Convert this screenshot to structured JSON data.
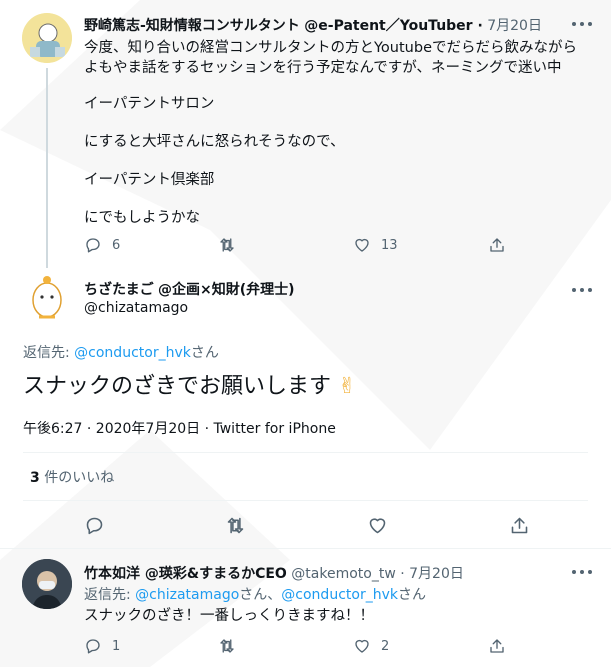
{
  "tweet1": {
    "name": "野崎篤志-知財情報コンサルタント",
    "handle_time": "@e-Patent／YouTuber ·",
    "date": "7月20日",
    "lines": [
      "今度、知り合いの経営コンサルタントの方とYoutubeでだらだら飲みながら",
      "よもやま話をするセッションを行う予定なんですが、ネーミングで迷い中",
      "イーパテントサロン",
      "にすると大坪さんに怒られそうなので、",
      "イーパテント倶楽部",
      "にでもしようかな"
    ],
    "reply_count": "6",
    "like_count": "13"
  },
  "tweet2": {
    "name": "ちざたまご",
    "name_suffix": "@企画×知財(弁理士)",
    "handle": "@chizatamago",
    "reply_prefix": "返信先:",
    "reply_to": "@conductor_hvk",
    "reply_suffix": "さん",
    "body": "スナックのざきでお願いします",
    "emoji": "✌",
    "meta": "午後6:27 · 2020年7月20日 · Twitter for iPhone",
    "likes_count": "3",
    "likes_label": "件のいいね"
  },
  "tweet3": {
    "name": "竹本如洋 @瑛彩&すまるかCEO",
    "handle": "@takemoto_tw ·",
    "date": "7月20日",
    "reply_prefix": "返信先:",
    "reply_to1": "@chizatamago",
    "reply_mid": "さん、",
    "reply_to2": "@conductor_hvk",
    "reply_suffix": "さん",
    "body": "スナックのざき！一番しっくりきますね！！",
    "reply_count": "1",
    "like_count": "2"
  },
  "colors": {
    "accent": "#1d9bf0",
    "muted": "#536471",
    "text": "#0f1419"
  }
}
